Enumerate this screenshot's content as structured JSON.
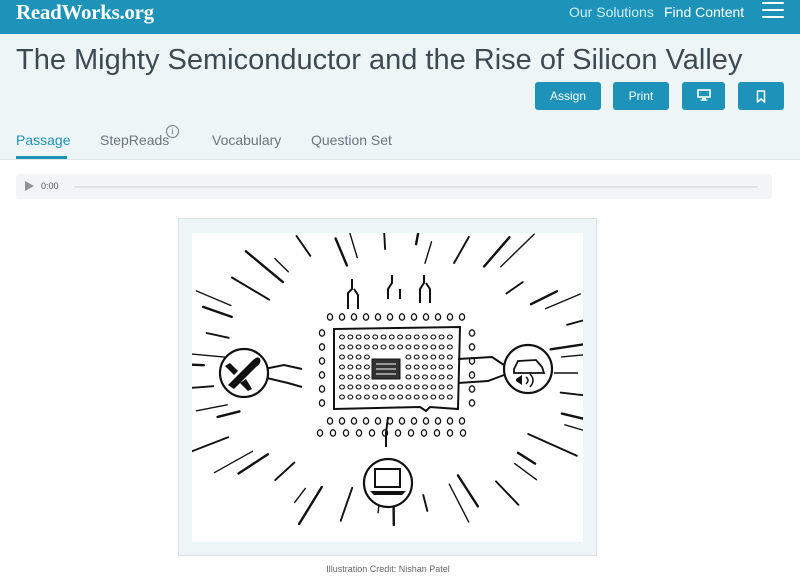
{
  "header": {
    "logo": "ReadWorks.org",
    "nav": {
      "solutions": "Our Solutions",
      "find_content": "Find Content"
    },
    "menu_icon": "hamburger-icon"
  },
  "article": {
    "title": "The Mighty Semiconductor and the Rise of Silicon Valley",
    "actions": {
      "assign": "Assign",
      "print": "Print",
      "present_icon": "monitor-icon",
      "save_icon": "bookmark-icon"
    }
  },
  "tabs": [
    {
      "label": "Passage",
      "active": true
    },
    {
      "label": "StepReads",
      "active": false,
      "info_icon": "info-icon"
    },
    {
      "label": "Vocabulary",
      "active": false
    },
    {
      "label": "Question Set",
      "active": false
    }
  ],
  "audio": {
    "time": "0:00",
    "play_icon": "play-icon"
  },
  "figure": {
    "caption": "Illustration Credit: Nishan Patel",
    "icons": [
      "microchip-icon",
      "airplane-icon",
      "car-icon",
      "laptop-icon"
    ]
  },
  "colors": {
    "brand": "#1d93b9",
    "band": "#eef5f7",
    "title_text": "#3e4a52"
  }
}
